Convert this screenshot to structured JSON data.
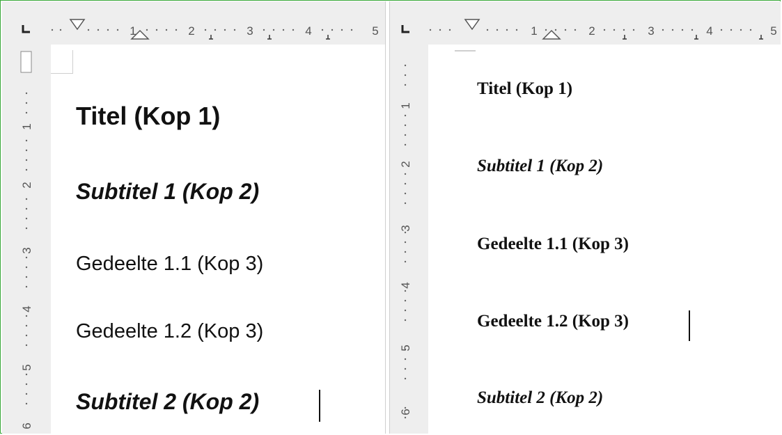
{
  "panes": [
    {
      "id": "left",
      "ruler_numbers": [
        "1",
        "2",
        "3",
        "4",
        "5"
      ],
      "vruler_numbers": [
        "1",
        "2",
        "3",
        "4",
        "5",
        "6"
      ],
      "headings": [
        {
          "text": "Titel (Kop 1)",
          "style": "Kop 1"
        },
        {
          "text": "Subtitel 1 (Kop 2)",
          "style": "Kop 2"
        },
        {
          "text": "Gedeelte 1.1 (Kop 3)",
          "style": "Kop 3"
        },
        {
          "text": "Gedeelte 1.2 (Kop 3)",
          "style": "Kop 3"
        },
        {
          "text": "Subtitel 2 (Kop 2)",
          "style": "Kop 2"
        }
      ]
    },
    {
      "id": "right",
      "ruler_numbers": [
        "1",
        "2",
        "3",
        "4",
        "5"
      ],
      "vruler_numbers": [
        "1",
        "2",
        "3",
        "4",
        "5",
        "6"
      ],
      "headings": [
        {
          "text": "Titel (Kop 1)",
          "style": "Kop 1"
        },
        {
          "text": "Subtitel 1 (Kop 2)",
          "style": "Kop 2"
        },
        {
          "text": "Gedeelte 1.1 (Kop 3)",
          "style": "Kop 3"
        },
        {
          "text": "Gedeelte 1.2 (Kop 3)",
          "style": "Kop 3"
        },
        {
          "text": "Subtitel 2 (Kop 2)",
          "style": "Kop 2"
        }
      ]
    }
  ],
  "colors": {
    "frame": "#3aa83a",
    "ruler_bg": "#eeeeee",
    "ruler_text": "#555555",
    "page": "#ffffff",
    "text": "#111111"
  }
}
